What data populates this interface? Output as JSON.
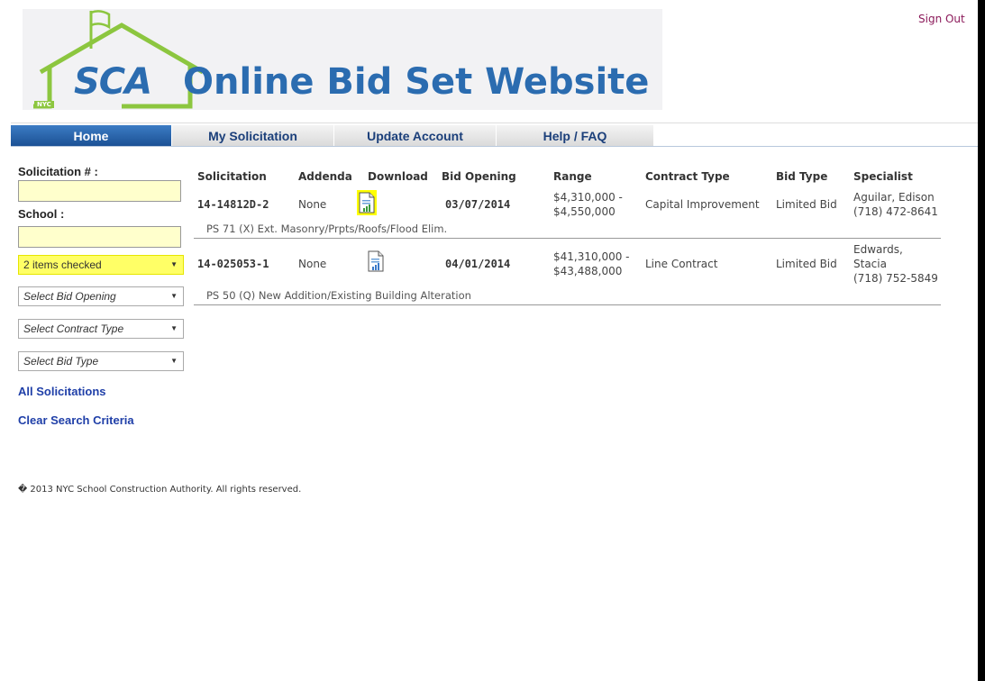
{
  "header": {
    "sign_out": "Sign Out",
    "logo_text": "SCA",
    "logo_badge": "NYC",
    "site_title": "Online Bid Set Website"
  },
  "nav": {
    "items": [
      {
        "label": "Home",
        "active": true
      },
      {
        "label": "My Solicitation",
        "active": false
      },
      {
        "label": "Update Account",
        "active": false
      },
      {
        "label": "Help / FAQ",
        "active": false
      }
    ]
  },
  "sidebar": {
    "solicitation_label": "Solicitation # :",
    "solicitation_value": "",
    "school_label": "School :",
    "school_value": "",
    "filters": [
      {
        "value": "2 items checked",
        "highlighted": true
      },
      {
        "value": "Select Bid Opening",
        "highlighted": false
      },
      {
        "value": "Select Contract Type",
        "highlighted": false
      },
      {
        "value": "Select Bid Type",
        "highlighted": false
      }
    ],
    "all_solicitations": "All Solicitations",
    "clear_search": "Clear Search Criteria"
  },
  "table": {
    "headers": [
      "Solicitation",
      "Addenda",
      "Download",
      "Bid Opening",
      "Range",
      "Contract Type",
      "Bid Type",
      "Specialist"
    ],
    "rows": [
      {
        "solicitation": "14-14812D-2",
        "addenda": "None",
        "bid_opening": "03/07/2014",
        "range_low": "$4,310,000 -",
        "range_high": "$4,550,000",
        "contract_type": "Capital Improvement",
        "bid_type": "Limited Bid",
        "specialist_name": "Aguilar, Edison",
        "specialist_phone": "(718) 472-8641",
        "description": "PS 71 (X) Ext. Masonry/Prpts/Roofs/Flood Elim.",
        "download_highlighted": true
      },
      {
        "solicitation": "14-025053-1",
        "addenda": "None",
        "bid_opening": "04/01/2014",
        "range_low": "$41,310,000 -",
        "range_high": "$43,488,000",
        "contract_type": "Line Contract",
        "bid_type": "Limited Bid",
        "specialist_name_1": "Edwards,",
        "specialist_name_2": "Stacia",
        "specialist_phone": "(718) 752-5849",
        "description": "PS 50 (Q) New Addition/Existing Building Alteration",
        "download_highlighted": false
      }
    ]
  },
  "footer": {
    "text": "� 2013 NYC School Construction Authority. All rights reserved."
  },
  "colors": {
    "brand_blue": "#2b6cb0",
    "nav_active": "#1a4f93",
    "highlight": "#ffff66",
    "link": "#1f3fa8",
    "sign_out": "#8b1a5a"
  }
}
